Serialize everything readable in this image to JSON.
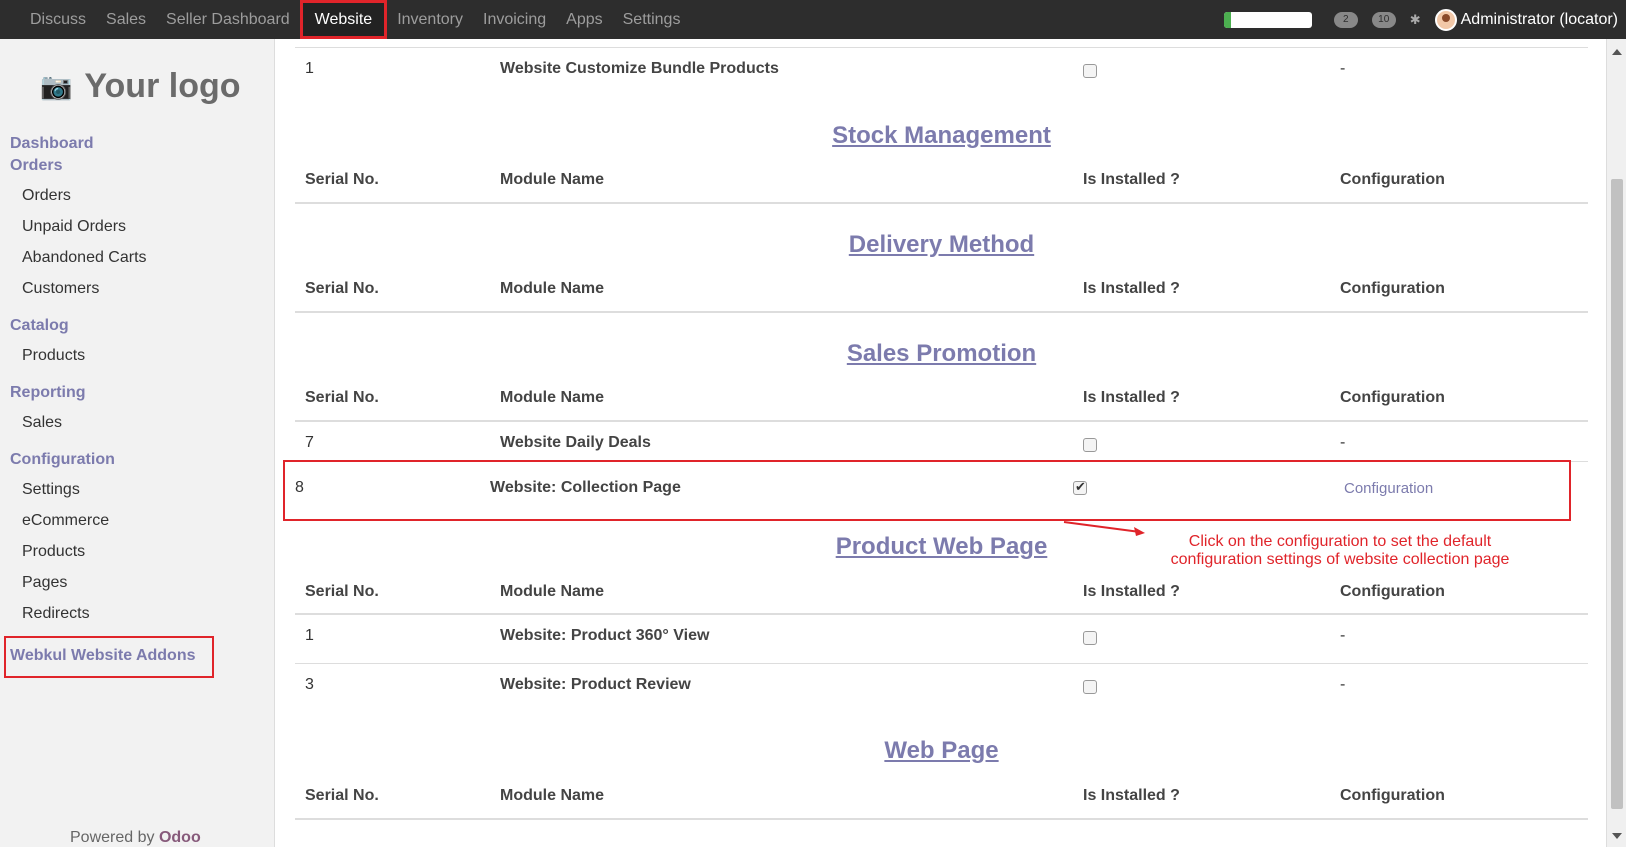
{
  "topbar": {
    "menu": [
      "Discuss",
      "Sales",
      "Seller Dashboard",
      "Website",
      "Inventory",
      "Invoicing",
      "Apps",
      "Settings"
    ],
    "active": "Website",
    "chat_count": "2",
    "message_count": "10",
    "user": "Administrator (locator)",
    "progress_fraction": 0.08
  },
  "sidebar": {
    "logo_text": "Your logo",
    "dashboard": "Dashboard",
    "orders_section": "Orders",
    "orders_items": [
      "Orders",
      "Unpaid Orders",
      "Abandoned Carts",
      "Customers"
    ],
    "catalog_section": "Catalog",
    "catalog_items": [
      "Products"
    ],
    "reporting_section": "Reporting",
    "reporting_items": [
      "Sales"
    ],
    "configuration_section": "Configuration",
    "configuration_items": [
      "Settings",
      "eCommerce",
      "Products",
      "Pages",
      "Redirects"
    ],
    "addons": "Webkul Website Addons",
    "powered_by": "Powered by",
    "powered_brand": "Odoo"
  },
  "headers": {
    "serial": "Serial No.",
    "module": "Module Name",
    "installed": "Is Installed ?",
    "configuration": "Configuration"
  },
  "top_row": {
    "serial": "1",
    "name": "Website Customize Bundle Products",
    "installed": false,
    "config": "-"
  },
  "sections": {
    "stock": "Stock Management",
    "delivery": "Delivery Method",
    "promotion": "Sales Promotion",
    "product_page": "Product Web Page",
    "web_page": "Web Page"
  },
  "promotion_rows": [
    {
      "serial": "7",
      "name": "Website Daily Deals",
      "installed": false,
      "config": "-"
    },
    {
      "serial": "8",
      "name": "Website: Collection Page",
      "installed": true,
      "config": "Configuration"
    }
  ],
  "product_rows": [
    {
      "serial": "1",
      "name": "Website: Product 360° View",
      "installed": false,
      "config": "-"
    },
    {
      "serial": "3",
      "name": "Website: Product Review",
      "installed": false,
      "config": "-"
    }
  ],
  "annotation": "Click on the configuration to set the default configuration settings of website collection page",
  "colors": {
    "accent": "#7c7bad",
    "highlight": "#e0242a",
    "topbar": "#2d2d2d"
  }
}
